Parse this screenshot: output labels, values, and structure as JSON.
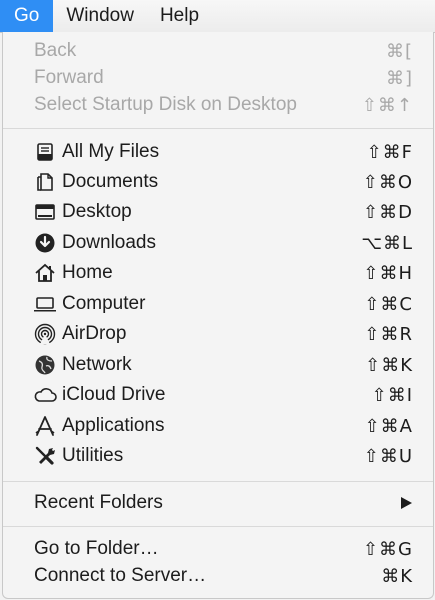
{
  "menubar": {
    "go": "Go",
    "window": "Window",
    "help": "Help"
  },
  "nav": [
    {
      "label": "Back",
      "shortcut": "⌘["
    },
    {
      "label": "Forward",
      "shortcut": "⌘]"
    },
    {
      "label": "Select Startup Disk on Desktop",
      "shortcut": "⇧⌘↑"
    }
  ],
  "places": [
    {
      "label": "All My Files",
      "shortcut": "⇧⌘F",
      "icon": "all-my-files-icon"
    },
    {
      "label": "Documents",
      "shortcut": "⇧⌘O",
      "icon": "documents-icon"
    },
    {
      "label": "Desktop",
      "shortcut": "⇧⌘D",
      "icon": "desktop-icon"
    },
    {
      "label": "Downloads",
      "shortcut": "⌥⌘L",
      "icon": "downloads-icon"
    },
    {
      "label": "Home",
      "shortcut": "⇧⌘H",
      "icon": "home-icon"
    },
    {
      "label": "Computer",
      "shortcut": "⇧⌘C",
      "icon": "computer-icon"
    },
    {
      "label": "AirDrop",
      "shortcut": "⇧⌘R",
      "icon": "airdrop-icon"
    },
    {
      "label": "Network",
      "shortcut": "⇧⌘K",
      "icon": "network-icon"
    },
    {
      "label": "iCloud Drive",
      "shortcut": "⇧⌘I",
      "icon": "icloud-icon"
    },
    {
      "label": "Applications",
      "shortcut": "⇧⌘A",
      "icon": "applications-icon"
    },
    {
      "label": "Utilities",
      "shortcut": "⇧⌘U",
      "icon": "utilities-icon"
    }
  ],
  "recent": {
    "label": "Recent Folders"
  },
  "bottom": [
    {
      "label": "Go to Folder…",
      "shortcut": "⇧⌘G"
    },
    {
      "label": "Connect to Server…",
      "shortcut": "⌘K"
    }
  ],
  "colors": {
    "highlight": "#2f8ef4",
    "disabled": "#a8a8a8"
  }
}
